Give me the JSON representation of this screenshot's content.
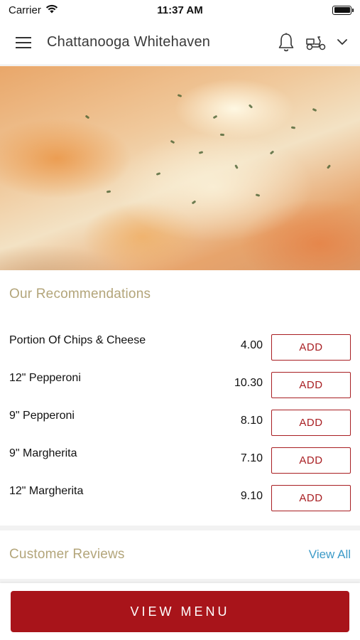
{
  "status_bar": {
    "carrier": "Carrier",
    "time": "11:37 AM"
  },
  "header": {
    "title": "Chattanooga Whitehaven",
    "icons": [
      "menu-icon",
      "bell-icon",
      "scooter-icon",
      "chevron-down-icon"
    ]
  },
  "hero": {
    "image": "pizza-photo"
  },
  "recommendations": {
    "title": "Our Recommendations",
    "items": [
      {
        "name": "Portion Of Chips & Cheese",
        "price": "4.00",
        "button": "ADD"
      },
      {
        "name": "12\" Pepperoni",
        "price": "10.30",
        "button": "ADD"
      },
      {
        "name": "9\" Pepperoni",
        "price": "8.10",
        "button": "ADD"
      },
      {
        "name": "9\" Margherita",
        "price": "7.10",
        "button": "ADD"
      },
      {
        "name": "12\" Margherita",
        "price": "9.10",
        "button": "ADD"
      }
    ]
  },
  "reviews": {
    "title": "Customer Reviews",
    "view_all": "View All"
  },
  "footer": {
    "view_menu": "VIEW MENU"
  },
  "colors": {
    "accent": "#a8141a",
    "section_title": "#b3a57a",
    "link": "#3d9bc8"
  }
}
